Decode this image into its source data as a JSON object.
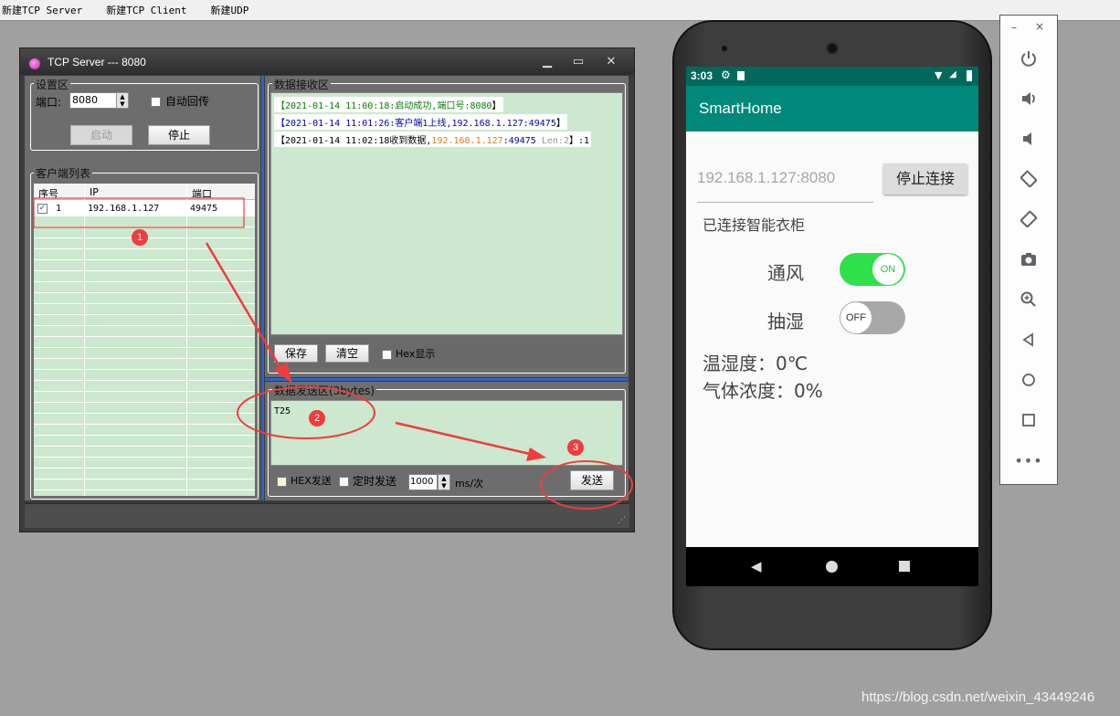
{
  "topmenu": [
    "新建TCP Server",
    "新建TCP Client",
    "新建UDP"
  ],
  "tcp_window": {
    "title": "TCP Server --- 8080",
    "settings": {
      "group_label": "设置区",
      "port_label": "端口:",
      "port_value": "8080",
      "auto_reply_label": "自动回传",
      "start_button": "启动",
      "stop_button": "停止"
    },
    "client_list": {
      "group_label": "客户端列表",
      "columns": [
        "序号",
        "IP",
        "端口"
      ],
      "rows": [
        {
          "index": "1",
          "ip": "192.168.1.127",
          "port": "49475",
          "checked": true
        }
      ]
    },
    "receive": {
      "group_label": "数据接收区",
      "log": [
        {
          "prefix": "【2021-01-14 11:00:18:",
          "text": "启动成功,端口号:8080",
          "suffix": "】",
          "color": "#0a7a0a"
        },
        {
          "prefix": "【2021-01-14 11:01:26:",
          "text": "客户端1上线,192.168.1.127:49475",
          "suffix": "】",
          "color": "#0000b0"
        },
        {
          "prefix": "【2021-01-14 11:02:18收到数据,",
          "ip": "192.168.1.127",
          "port": ":49475",
          "len": "Len:2",
          "tail": "】:1",
          "color": "#000"
        }
      ],
      "save_button": "保存",
      "clear_button": "清空",
      "hex_display_label": "Hex显示"
    },
    "send": {
      "group_label": "数据发送区(3bytes)",
      "text": "T25",
      "hex_send_label": "HEX发送",
      "timed_send_label": "定时发送",
      "interval_value": "1000",
      "interval_unit": "ms/次",
      "send_button": "发送"
    }
  },
  "annotations": [
    "1",
    "2",
    "3"
  ],
  "phone": {
    "status_time": "3:03",
    "app_title": "SmartHome",
    "address_value": "192.168.1.127:8080",
    "disconnect_button": "停止连接",
    "connection_status": "已连接智能衣柜",
    "ventilation_label": "通风",
    "ventilation_state": "ON",
    "dehumidify_label": "抽湿",
    "dehumidify_state": "OFF",
    "temp_humidity": "温湿度：0℃",
    "gas_concentration": "气体浓度：0%"
  },
  "emulator_toolbar": {
    "buttons": [
      "power-icon",
      "volume-up-icon",
      "volume-down-icon",
      "rotate-left-icon",
      "rotate-right-icon",
      "camera-icon",
      "zoom-icon",
      "back-icon",
      "home-icon",
      "overview-icon",
      "more-icon"
    ]
  },
  "watermark": "https://blog.csdn.net/weixin_43449246",
  "colors": {
    "accent": "#00897b",
    "switch_on": "#2ee04a",
    "annotation": "#f03c3c"
  }
}
